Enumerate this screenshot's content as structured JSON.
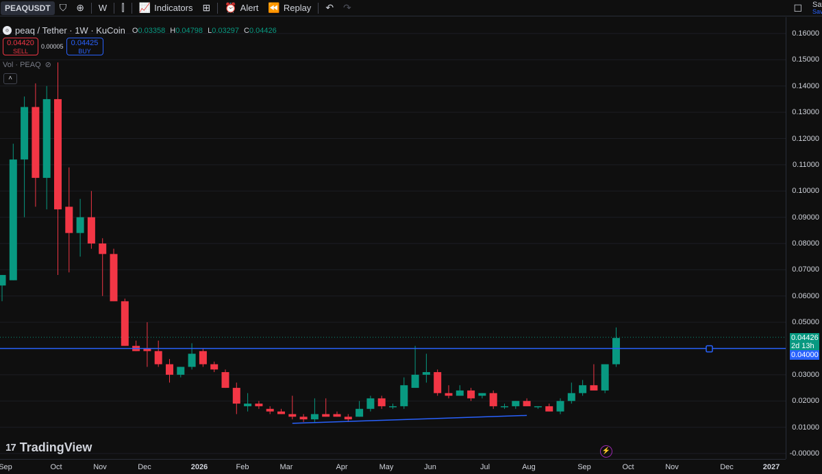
{
  "toolbar": {
    "symbol": "PEAQUSDT",
    "interval": "W",
    "indicators_label": "Indicators",
    "alert_label": "Alert",
    "replay_label": "Replay",
    "save_label": "Save",
    "save_sub": "Save"
  },
  "legend": {
    "title": "peaq / Tether · 1W · KuCoin",
    "ohlc": {
      "o_key": "O",
      "o": "0.03358",
      "h_key": "H",
      "h": "0.04798",
      "l_key": "L",
      "l": "0.03297",
      "c_key": "C",
      "c": "0.04426"
    }
  },
  "trade": {
    "sell_price": "0.04420",
    "sell_label": "SELL",
    "spread": "0.00005",
    "buy_price": "0.04425",
    "buy_label": "BUY"
  },
  "volume_label": "Vol · PEAQ",
  "collapse_label": "˄",
  "current_price": {
    "value": "0.04426",
    "countdown": "2d 13h"
  },
  "horizontal_level": "0.04000",
  "logo_text": "TradingView",
  "colors": {
    "up": "#089981",
    "down": "#f23645",
    "line": "#2962ff",
    "bg": "#0f0f0f"
  },
  "chart_data": {
    "type": "candlestick",
    "price_axis": [
      "0.16000",
      "0.15000",
      "0.14000",
      "0.13000",
      "0.12000",
      "0.11000",
      "0.10000",
      "0.09000",
      "0.08000",
      "0.07000",
      "0.06000",
      "0.05000",
      "0.04000",
      "0.03000",
      "0.02000",
      "0.01000",
      "-0.00000"
    ],
    "time_axis": [
      {
        "label": "Sep",
        "bold": false
      },
      {
        "label": "Oct",
        "bold": false
      },
      {
        "label": "Nov",
        "bold": false
      },
      {
        "label": "Dec",
        "bold": false
      },
      {
        "label": "2026",
        "bold": true
      },
      {
        "label": "Feb",
        "bold": false
      },
      {
        "label": "Mar",
        "bold": false
      },
      {
        "label": "Apr",
        "bold": false
      },
      {
        "label": "May",
        "bold": false
      },
      {
        "label": "Jun",
        "bold": false
      },
      {
        "label": "Jul",
        "bold": false
      },
      {
        "label": "Aug",
        "bold": false
      },
      {
        "label": "Sep",
        "bold": false
      },
      {
        "label": "Oct",
        "bold": false
      },
      {
        "label": "Nov",
        "bold": false
      },
      {
        "label": "Dec",
        "bold": false
      },
      {
        "label": "2027",
        "bold": true
      }
    ],
    "candles": [
      {
        "o": 0.064,
        "h": 0.068,
        "l": 0.058,
        "c": 0.068
      },
      {
        "o": 0.066,
        "h": 0.118,
        "l": 0.066,
        "c": 0.112
      },
      {
        "o": 0.112,
        "h": 0.136,
        "l": 0.09,
        "c": 0.132
      },
      {
        "o": 0.132,
        "h": 0.141,
        "l": 0.094,
        "c": 0.105
      },
      {
        "o": 0.105,
        "h": 0.14,
        "l": 0.093,
        "c": 0.135
      },
      {
        "o": 0.135,
        "h": 0.149,
        "l": 0.068,
        "c": 0.093
      },
      {
        "o": 0.094,
        "h": 0.109,
        "l": 0.069,
        "c": 0.084
      },
      {
        "o": 0.084,
        "h": 0.097,
        "l": 0.075,
        "c": 0.09
      },
      {
        "o": 0.09,
        "h": 0.1,
        "l": 0.078,
        "c": 0.08
      },
      {
        "o": 0.08,
        "h": 0.082,
        "l": 0.06,
        "c": 0.076
      },
      {
        "o": 0.076,
        "h": 0.078,
        "l": 0.058,
        "c": 0.058
      },
      {
        "o": 0.058,
        "h": 0.059,
        "l": 0.041,
        "c": 0.041
      },
      {
        "o": 0.041,
        "h": 0.043,
        "l": 0.039,
        "c": 0.039
      },
      {
        "o": 0.04,
        "h": 0.05,
        "l": 0.033,
        "c": 0.039
      },
      {
        "o": 0.039,
        "h": 0.043,
        "l": 0.033,
        "c": 0.034
      },
      {
        "o": 0.034,
        "h": 0.036,
        "l": 0.027,
        "c": 0.03
      },
      {
        "o": 0.03,
        "h": 0.033,
        "l": 0.029,
        "c": 0.033
      },
      {
        "o": 0.033,
        "h": 0.042,
        "l": 0.032,
        "c": 0.038
      },
      {
        "o": 0.039,
        "h": 0.04,
        "l": 0.033,
        "c": 0.034
      },
      {
        "o": 0.034,
        "h": 0.035,
        "l": 0.031,
        "c": 0.032
      },
      {
        "o": 0.031,
        "h": 0.032,
        "l": 0.025,
        "c": 0.025
      },
      {
        "o": 0.025,
        "h": 0.027,
        "l": 0.015,
        "c": 0.019
      },
      {
        "o": 0.018,
        "h": 0.023,
        "l": 0.016,
        "c": 0.019
      },
      {
        "o": 0.019,
        "h": 0.02,
        "l": 0.017,
        "c": 0.018
      },
      {
        "o": 0.017,
        "h": 0.018,
        "l": 0.015,
        "c": 0.016
      },
      {
        "o": 0.016,
        "h": 0.017,
        "l": 0.015,
        "c": 0.015
      },
      {
        "o": 0.015,
        "h": 0.022,
        "l": 0.013,
        "c": 0.014
      },
      {
        "o": 0.014,
        "h": 0.015,
        "l": 0.012,
        "c": 0.013
      },
      {
        "o": 0.013,
        "h": 0.021,
        "l": 0.012,
        "c": 0.015
      },
      {
        "o": 0.015,
        "h": 0.021,
        "l": 0.014,
        "c": 0.014
      },
      {
        "o": 0.015,
        "h": 0.016,
        "l": 0.014,
        "c": 0.014
      },
      {
        "o": 0.014,
        "h": 0.015,
        "l": 0.012,
        "c": 0.013
      },
      {
        "o": 0.014,
        "h": 0.02,
        "l": 0.014,
        "c": 0.017
      },
      {
        "o": 0.017,
        "h": 0.022,
        "l": 0.016,
        "c": 0.021
      },
      {
        "o": 0.021,
        "h": 0.022,
        "l": 0.017,
        "c": 0.018
      },
      {
        "o": 0.018,
        "h": 0.019,
        "l": 0.017,
        "c": 0.018
      },
      {
        "o": 0.018,
        "h": 0.029,
        "l": 0.017,
        "c": 0.026
      },
      {
        "o": 0.025,
        "h": 0.041,
        "l": 0.025,
        "c": 0.03
      },
      {
        "o": 0.03,
        "h": 0.038,
        "l": 0.027,
        "c": 0.031
      },
      {
        "o": 0.031,
        "h": 0.032,
        "l": 0.022,
        "c": 0.023
      },
      {
        "o": 0.023,
        "h": 0.026,
        "l": 0.021,
        "c": 0.022
      },
      {
        "o": 0.022,
        "h": 0.026,
        "l": 0.022,
        "c": 0.024
      },
      {
        "o": 0.024,
        "h": 0.025,
        "l": 0.02,
        "c": 0.021
      },
      {
        "o": 0.022,
        "h": 0.023,
        "l": 0.021,
        "c": 0.023
      },
      {
        "o": 0.023,
        "h": 0.024,
        "l": 0.017,
        "c": 0.018
      },
      {
        "o": 0.018,
        "h": 0.019,
        "l": 0.017,
        "c": 0.018
      },
      {
        "o": 0.018,
        "h": 0.02,
        "l": 0.017,
        "c": 0.02
      },
      {
        "o": 0.02,
        "h": 0.021,
        "l": 0.018,
        "c": 0.018
      },
      {
        "o": 0.018,
        "h": 0.018,
        "l": 0.017,
        "c": 0.018
      },
      {
        "o": 0.018,
        "h": 0.019,
        "l": 0.016,
        "c": 0.016
      },
      {
        "o": 0.016,
        "h": 0.021,
        "l": 0.015,
        "c": 0.02
      },
      {
        "o": 0.02,
        "h": 0.027,
        "l": 0.019,
        "c": 0.023
      },
      {
        "o": 0.023,
        "h": 0.028,
        "l": 0.022,
        "c": 0.026
      },
      {
        "o": 0.026,
        "h": 0.034,
        "l": 0.025,
        "c": 0.024
      },
      {
        "o": 0.024,
        "h": 0.034,
        "l": 0.023,
        "c": 0.034
      },
      {
        "o": 0.034,
        "h": 0.048,
        "l": 0.033,
        "c": 0.044
      }
    ],
    "horizontal_line": 0.04,
    "trendline": [
      {
        "candle": 26,
        "price": 0.0115
      },
      {
        "candle": 47,
        "price": 0.0145
      }
    ],
    "ylim": [
      -0.0007,
      0.1665
    ]
  }
}
